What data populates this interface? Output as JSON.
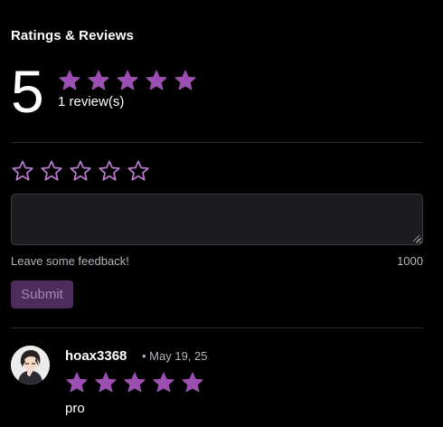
{
  "ratings": {
    "heading": "Ratings & Reviews",
    "average": "5",
    "average_stars": 5,
    "review_count_text": "1 review(s)"
  },
  "form": {
    "star_count": 5,
    "selected_stars": 0,
    "feedback_value": "",
    "hint": "Leave some feedback!",
    "max_chars": "1000",
    "submit_label": "Submit"
  },
  "reviews": [
    {
      "username": "hoax3368",
      "date": "• May 19, 25",
      "stars": 5,
      "text": "pro"
    }
  ],
  "colors": {
    "star_fill": "#9b4fb0",
    "star_outline": "#b77ccc",
    "submit_bg": "#4d2b5a",
    "background": "#000000"
  },
  "icons": {
    "star": "star-icon",
    "avatar": "user-avatar"
  }
}
